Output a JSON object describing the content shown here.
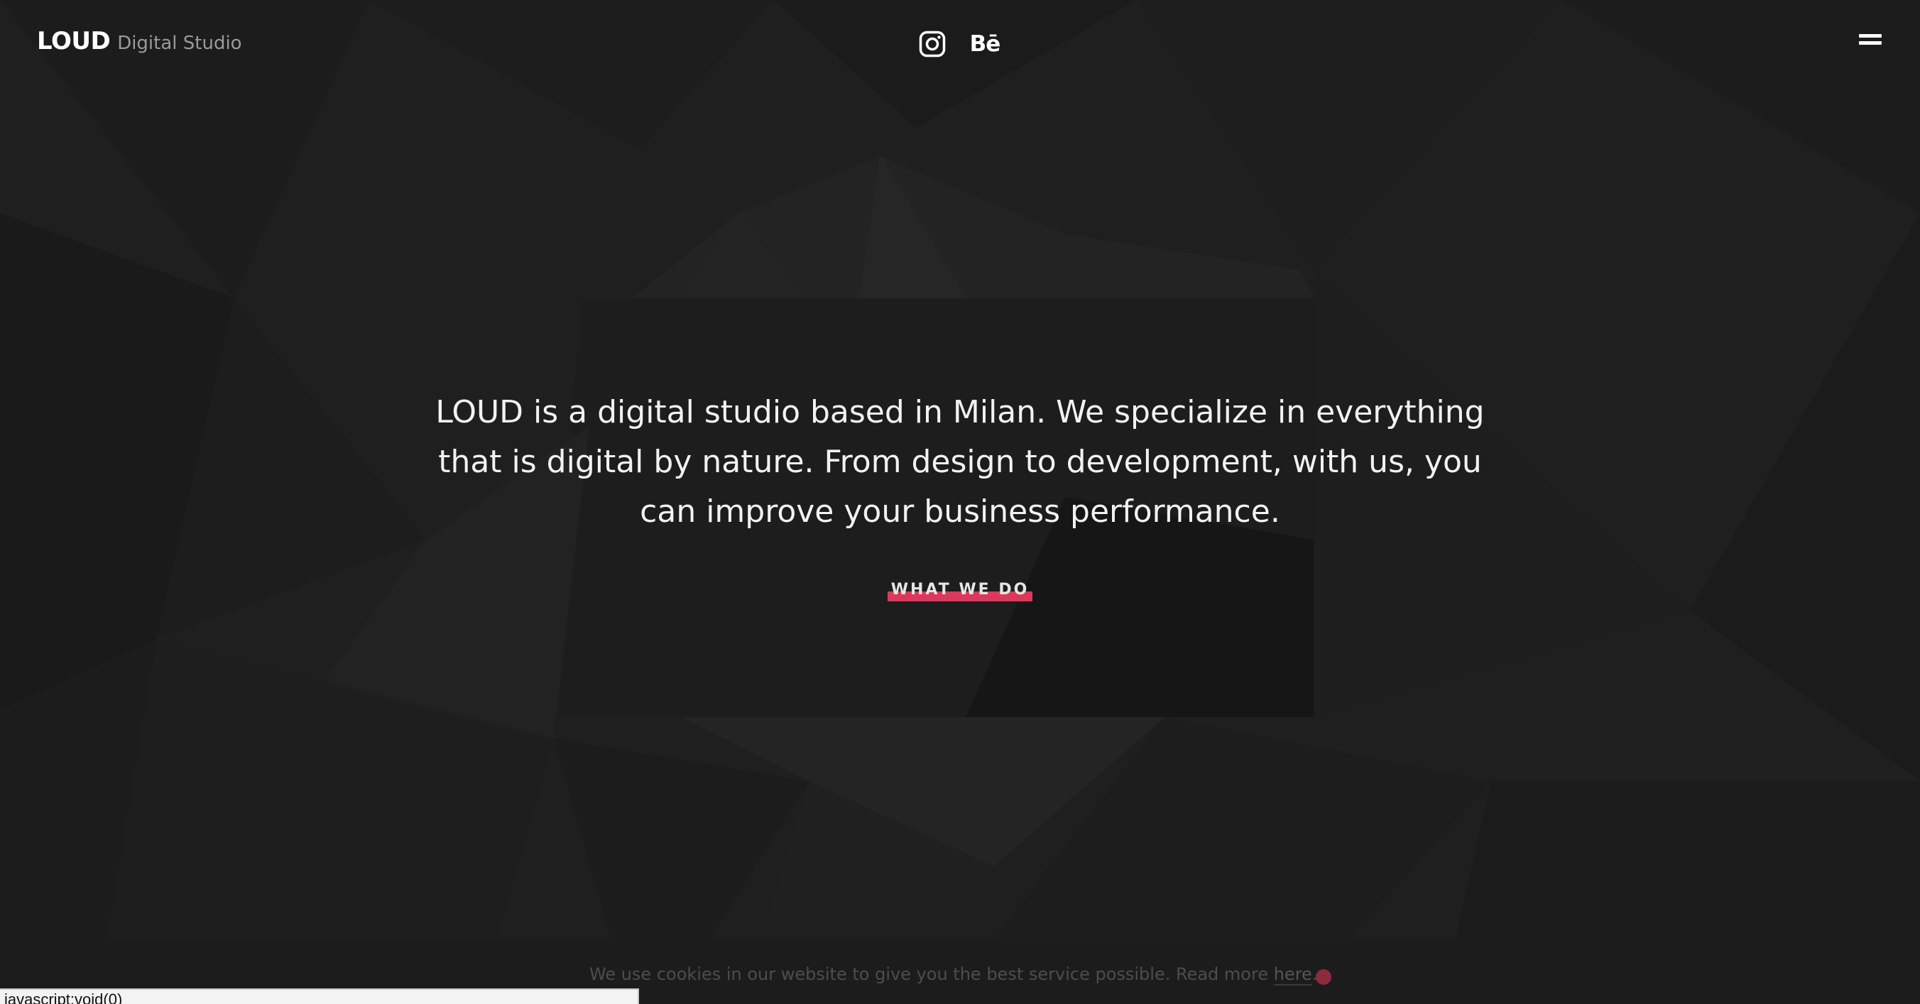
{
  "header": {
    "logo_main": "LOUD",
    "logo_sub": "Digital Studio",
    "social": [
      {
        "name": "instagram-icon"
      },
      {
        "name": "behance-icon",
        "label": "Bē"
      }
    ],
    "menu_icon": "hamburger-icon"
  },
  "hero": {
    "text": "LOUD is a digital studio based in Milan. We specialize in everything that is digital by nature. From design to development, with us, you can improve your business performance.",
    "cta_label": "WHAT WE DO"
  },
  "cookie": {
    "text": "We use cookies in our website to give you the best service possible. Read more ",
    "link_label": "here",
    "suffix": "."
  },
  "status_bar": {
    "url": "javascript:void(0)"
  },
  "colors": {
    "background": "#1f1f1f",
    "accent": "#d93a5c",
    "cookie_dot": "#8e2a3e",
    "text": "#ffffff"
  }
}
